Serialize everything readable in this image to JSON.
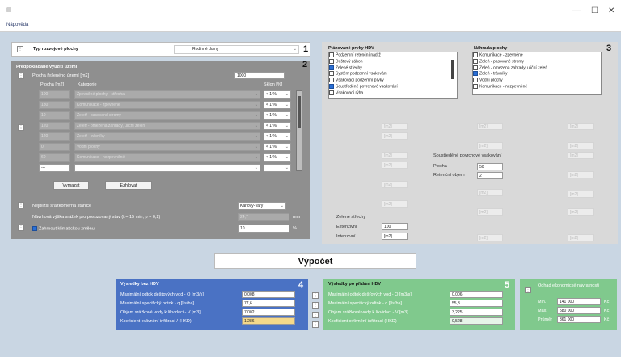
{
  "window": {
    "minimize": "—",
    "maximize": "☐",
    "close": "✕",
    "menu": "Nápověda"
  },
  "section1": {
    "number": "1",
    "label": "Typ rozvojové plochy",
    "value": "Rodinné domy"
  },
  "section2": {
    "number": "2",
    "title": "Předpokládané využití území",
    "area_label": "Plocha řešeného území [m2]",
    "area_value": "1000",
    "col_area": "Plocha [m2]",
    "col_category": "Kategorie",
    "col_slope": "Sklon [%]",
    "rows": [
      {
        "area": "100",
        "category": "Zpevněné plochy - střecha",
        "slope": "< 1 %"
      },
      {
        "area": "180",
        "category": "Komunikace - zpevněné",
        "slope": "< 1 %"
      },
      {
        "area": "10",
        "category": "Zeleň - pasované stromy",
        "slope": "< 1 %"
      },
      {
        "area": "120",
        "category": "Zeleň - omezená zahrady, uliční zeleň",
        "slope": "< 1 %"
      },
      {
        "area": "120",
        "category": "Zeleň - trávníky",
        "slope": "< 1 %"
      },
      {
        "area": "0",
        "category": "Vodní plochy",
        "slope": "< 1 %"
      },
      {
        "area": "60",
        "category": "Komunikace - nezpevněné",
        "slope": "< 1 %"
      },
      {
        "area": "---",
        "category": "",
        "slope": ""
      }
    ],
    "btn_delete": "Vymazat",
    "btn_add": "Ezhlovat",
    "storm_label": "Nejbližší srážkoměrná stanice",
    "storm_value": "Karlovy-Vary",
    "depth_label": "Návrhová výška srážek pro posuzovaný stav (t = 15 min, p = 0,2)",
    "depth_value": "24,7",
    "depth_unit": "mm",
    "climate_label": "Zahrnout klimatickou změnu",
    "climate_value": "10",
    "climate_unit": "%"
  },
  "section3": {
    "number": "3",
    "hdv_title": "Plánované prvky HDV",
    "hdv_items": [
      {
        "label": "Podzemní retenční nádrž",
        "checked": false
      },
      {
        "label": "Dešťový záhon",
        "checked": false
      },
      {
        "label": "Zelené střechy",
        "checked": true
      },
      {
        "label": "Systém podzemní vsakování",
        "checked": false
      },
      {
        "label": "Vsakovací podzemní prvky",
        "checked": false
      },
      {
        "label": "Soustředěné povrchové vsakování",
        "checked": true
      },
      {
        "label": "Vsakovací rýha",
        "checked": false
      }
    ],
    "replace_title": "Náhrada plochy",
    "replace_items": [
      {
        "label": "Komunikace - zpevněné",
        "checked": false
      },
      {
        "label": "Zeleň - pasované stromy",
        "checked": false
      },
      {
        "label": "Zeleň - omezená zahrady, uliční zeleň",
        "checked": false
      },
      {
        "label": "Zeleň - trávníky",
        "checked": true
      },
      {
        "label": "Vodní plochy",
        "checked": false
      },
      {
        "label": "Komunikace - nezpevněné",
        "checked": false
      }
    ],
    "unit": "[m2]",
    "surface_title": "Soustředěné povrchové vsakování",
    "surface_area_label": "Plocha",
    "surface_area_value": "50",
    "surface_vol_label": "Retenční objem",
    "surface_vol_value": "2",
    "green_title": "Zelené střechy",
    "green_ext_label": "Extenzivní",
    "green_ext_value": "100",
    "green_int_label": "Intenzivní",
    "green_int_value": "[m2]"
  },
  "calc": {
    "label": "Výpočet"
  },
  "results_without": {
    "number": "4",
    "title": "Výsledky bez HDV",
    "rows": [
      {
        "label": "Maximální odtok dešťových vod - Q [m3/s]",
        "value": "0,008"
      },
      {
        "label": "Maximální specifický odtok - q [l/s/ha]",
        "value": "77,6"
      },
      {
        "label": "Objem srážkové vody k likvidaci - V [m3]",
        "value": "7,002"
      },
      {
        "label": "Koeficient ovlivnění infiltrací / (HKD)",
        "value": "1,286"
      }
    ]
  },
  "results_with": {
    "number": "5",
    "title": "Výsledky po přidání HDV",
    "rows": [
      {
        "label": "Maximální odtok dešťových vod - Q [m3/s]",
        "value": "0,006"
      },
      {
        "label": "Maximální specifický odtok - q [l/s/ha]",
        "value": "55,3"
      },
      {
        "label": "Objem srážkové vody k likvidaci - V [m3]",
        "value": "3,225"
      },
      {
        "label": "Koeficient ovlivnění infiltrací (HKD)",
        "value": "0,528"
      }
    ]
  },
  "savings": {
    "title": "Odhad ekonomické návratnosti",
    "rows": [
      {
        "label": "Min.",
        "value": "141 000",
        "unit": "Kč"
      },
      {
        "label": "Max.",
        "value": "580 000",
        "unit": "Kč"
      },
      {
        "label": "Průměr",
        "value": "361 000",
        "unit": "Kč"
      }
    ]
  },
  "colors": {
    "gray_panel": "#8f8f8f",
    "blue_panel": "#4a72c4",
    "green_panel": "#80c98d",
    "background": "#c9d6e3",
    "checkbox_on": "#2a6fd6"
  }
}
